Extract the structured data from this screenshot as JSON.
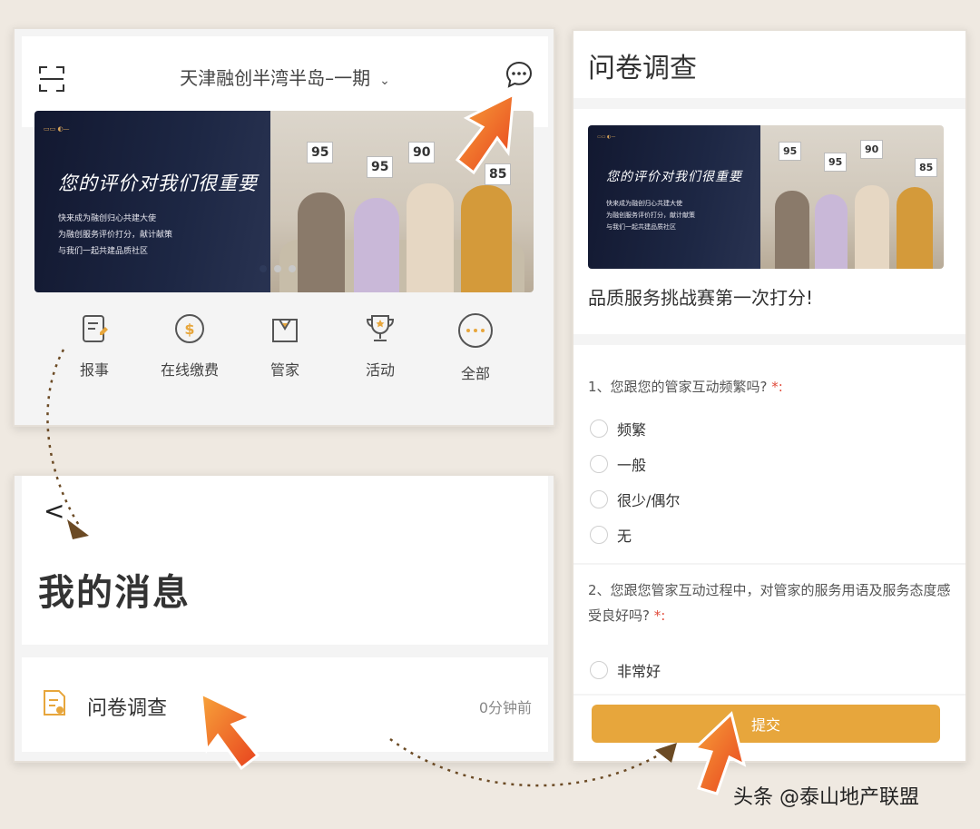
{
  "home": {
    "title": "天津融创半湾半岛–一期",
    "chevron": "⌄",
    "banner": {
      "headline": "您的评价对我们很重要",
      "sub_lines": [
        "快来成为融创归心共建大使",
        "为融创服务评价打分，献计献策",
        "与我们一起共建品质社区"
      ],
      "scores": [
        "95",
        "95",
        "90",
        "85"
      ]
    },
    "quick_actions": [
      {
        "label": "报事",
        "icon": "report-icon"
      },
      {
        "label": "在线缴费",
        "icon": "payment-icon"
      },
      {
        "label": "管家",
        "icon": "butler-icon"
      },
      {
        "label": "活动",
        "icon": "trophy-icon"
      },
      {
        "label": "全部",
        "icon": "more-icon"
      }
    ]
  },
  "messages": {
    "back": "<",
    "title": "我的消息",
    "item": {
      "label": "问卷调查",
      "time": "0分钟前",
      "icon": "survey-doc-icon"
    }
  },
  "survey": {
    "title": "问卷调查",
    "subtitle": "品质服务挑战赛第一次打分!",
    "q1": {
      "text": "1、您跟您的管家互动频繁吗?",
      "req": "*:",
      "options": [
        "频繁",
        "一般",
        "很少/偶尔",
        "无"
      ]
    },
    "q2": {
      "text": "2、您跟您管家互动过程中，对管家的服务用语及服务态度感受良好吗?",
      "req": "*:",
      "options": [
        "非常好"
      ]
    },
    "submit": "提交"
  },
  "watermark": "头条 @泰山地产联盟",
  "colors": {
    "accent": "#e7a63c",
    "arrow": "#ef5a24",
    "banner_dark": "#1d2744"
  }
}
